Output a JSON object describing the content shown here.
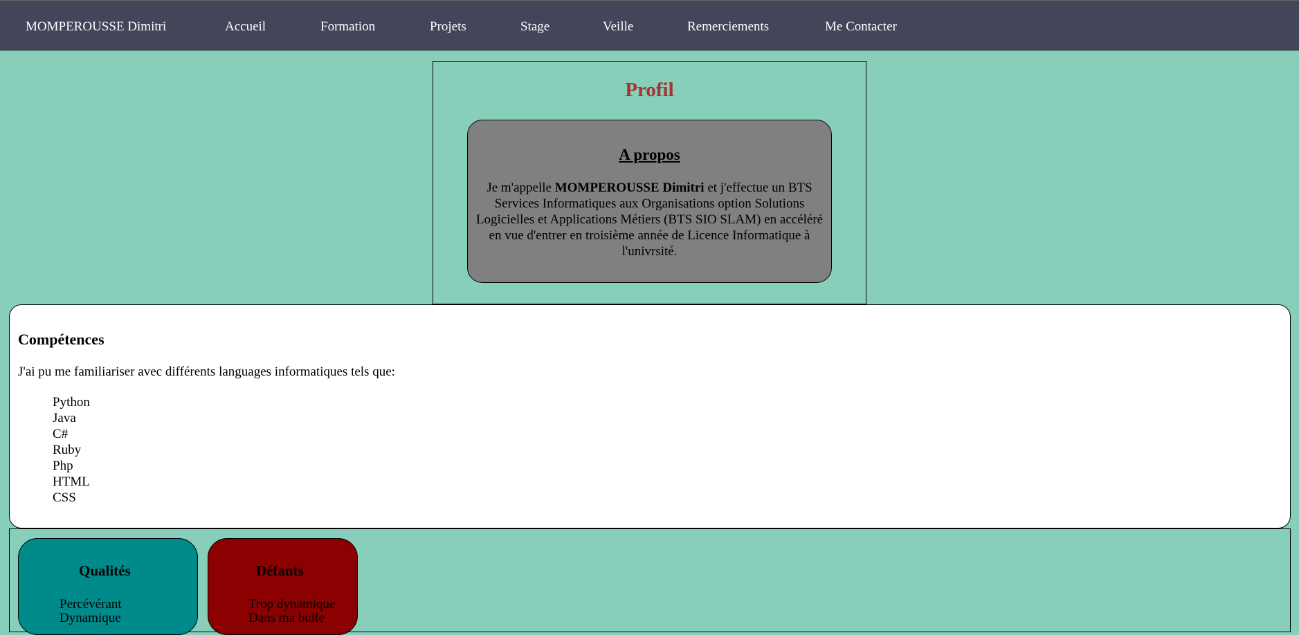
{
  "nav": {
    "brand": "MOMPEROUSSE Dimitri",
    "items": [
      "Accueil",
      "Formation",
      "Projets",
      "Stage",
      "Veille",
      "Remerciements",
      "Me Contacter"
    ]
  },
  "profil": {
    "title": "Profil",
    "apropos": {
      "title": "A propos",
      "text_before": "Je m'appelle ",
      "name_bold": "MOMPEROUSSE Dimitri",
      "text_after": " et j'effectue un BTS Services Informatiques aux Organisations option Solutions Logicielles et Applications Métiers (BTS SIO SLAM) en accéléré en vue d'entrer en troisième année de Licence Informatique à l'univrsité."
    }
  },
  "competences": {
    "title": "Compétences",
    "intro": "J'ai pu me familiariser avec différents languages informatiques tels que:",
    "languages": [
      "Python",
      "Java",
      "C#",
      "Ruby",
      "Php",
      "HTML",
      "CSS"
    ]
  },
  "qualites": {
    "title": "Qualités",
    "items": [
      "Percévérant",
      "Dynamique"
    ]
  },
  "defauts": {
    "title": "Défants",
    "items": [
      "Trop dynamique",
      "Dans ma bulle"
    ]
  },
  "colors": {
    "page_background": "#88cfbb",
    "navbar": "#43455a",
    "profil_title": "#a83232",
    "apropos_box": "#808080",
    "qualites_card": "#008a8a",
    "defauts_card": "#8b0000"
  }
}
